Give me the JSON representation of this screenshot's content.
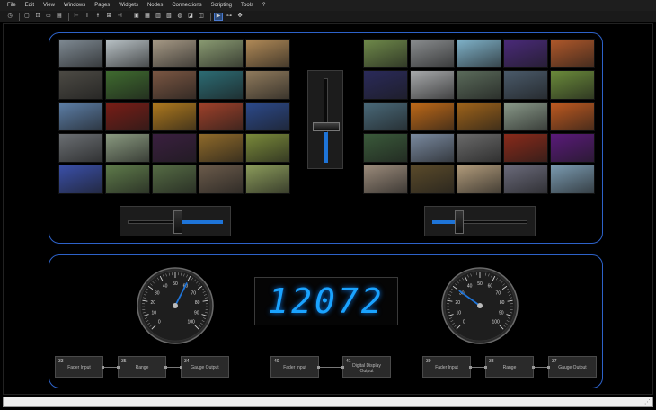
{
  "menu": [
    "File",
    "Edit",
    "View",
    "Windows",
    "Pages",
    "Widgets",
    "Nodes",
    "Connections",
    "Scripting",
    "Tools",
    "?"
  ],
  "toolbar": [
    {
      "name": "clock-icon",
      "glyph": "◷"
    },
    {
      "name": "sep"
    },
    {
      "name": "frame-icon",
      "glyph": "▢"
    },
    {
      "name": "group-icon",
      "glyph": "⊡"
    },
    {
      "name": "text-box-icon",
      "glyph": "▭"
    },
    {
      "name": "list-icon",
      "glyph": "▤"
    },
    {
      "name": "sep"
    },
    {
      "name": "align-left-icon",
      "glyph": "⊢"
    },
    {
      "name": "text-tool-icon",
      "glyph": "T"
    },
    {
      "name": "text-tool-2-icon",
      "glyph": "Ŧ"
    },
    {
      "name": "align-icon",
      "glyph": "⊞"
    },
    {
      "name": "align-right-icon",
      "glyph": "⊣"
    },
    {
      "name": "sep"
    },
    {
      "name": "image-icon",
      "glyph": "▣"
    },
    {
      "name": "window-icon",
      "glyph": "▦"
    },
    {
      "name": "display-icon",
      "glyph": "▥"
    },
    {
      "name": "panel-icon",
      "glyph": "▧"
    },
    {
      "name": "globe-icon",
      "glyph": "◍"
    },
    {
      "name": "node-icon",
      "glyph": "◪"
    },
    {
      "name": "script-icon",
      "glyph": "◫"
    },
    {
      "name": "sep"
    },
    {
      "name": "play-icon",
      "glyph": "▶",
      "active": true
    },
    {
      "name": "connect-icon",
      "glyph": "⊶"
    },
    {
      "name": "move-icon",
      "glyph": "✥"
    }
  ],
  "thumbs_left": [
    [
      "#7f8a93",
      "#b9c2c6",
      "#a79a86",
      "#8a9b72",
      "#b18a57"
    ],
    [
      "#4c4a44",
      "#3f6b2f",
      "#7a5642",
      "#2c6b73",
      "#8f7a5c"
    ],
    [
      "#5d7fa8",
      "#7a1d16",
      "#b07a1e",
      "#a0412a",
      "#2c4a8c"
    ],
    [
      "#6b6f73",
      "#8a9a80",
      "#3a1f3f",
      "#8f6a2a",
      "#7a8a3a"
    ],
    [
      "#3a4fa8",
      "#5e7a4a",
      "#556b44",
      "#6a5a4a",
      "#8a9a5a"
    ]
  ],
  "thumbs_right": [
    [
      "#6f8a4a",
      "#8a8d8f",
      "#7fb2c9",
      "#4a2a7a",
      "#b0582a"
    ],
    [
      "#2a2a5a",
      "#a7a9ab",
      "#5a6a5a",
      "#4a5a6a",
      "#6a8a3a"
    ],
    [
      "#4a6a7a",
      "#c06a18",
      "#a0641a",
      "#8a9a8a",
      "#c05a20"
    ],
    [
      "#3a5a3a",
      "#7a8aa0",
      "#6a6a6a",
      "#8a2a1a",
      "#5a1a7a"
    ],
    [
      "#9a8a7a",
      "#5a4a2a",
      "#b09a7a",
      "#6a6a7a",
      "#7a9ab0"
    ]
  ],
  "sliders": {
    "left_level": 0.53,
    "right_level": 0.28,
    "vertical_level": 0.43
  },
  "gauges": {
    "left": {
      "ticks": [
        "0",
        "10",
        "20",
        "30",
        "40",
        "50",
        "60",
        "70",
        "80",
        "90",
        "100"
      ],
      "value": 60
    },
    "right": {
      "ticks": [
        "0",
        "10",
        "20",
        "30",
        "40",
        "50",
        "60",
        "70",
        "80",
        "90",
        "100"
      ],
      "value": 30
    }
  },
  "digital_display": "12072",
  "nodes": {
    "left": [
      {
        "id": "33",
        "label": "Fader Input"
      },
      {
        "id": "35",
        "label": "Range"
      },
      {
        "id": "34",
        "label": "Gauge Output"
      }
    ],
    "center": [
      {
        "id": "40",
        "label": "Fader Input"
      },
      {
        "id": "41",
        "label": "Digital Display Output"
      }
    ],
    "right": [
      {
        "id": "39",
        "label": "Fader Input"
      },
      {
        "id": "38",
        "label": "Range"
      },
      {
        "id": "37",
        "label": "Gauge Output"
      }
    ]
  },
  "colors": {
    "accent": "#2d62c9",
    "fill": "#1e74d8",
    "digit": "#1aa3ff"
  }
}
